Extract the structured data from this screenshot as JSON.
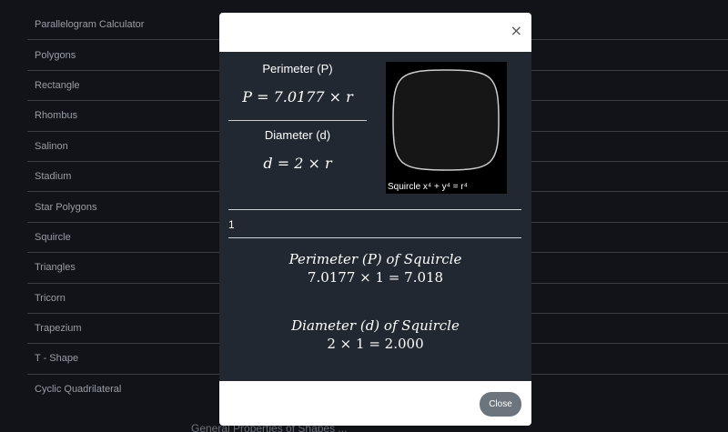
{
  "background": {
    "items": [
      "Parallelogram Calculator",
      "Polygons",
      "Rectangle",
      "Rhombus",
      "Salinon",
      "Stadium",
      "Star Polygons",
      "Squircle",
      "Triangles",
      "Tricorn",
      "Trapezium",
      "T - Shape",
      "Cyclic Quadrilateral"
    ],
    "footer_text": "General Properties of Shapes ..."
  },
  "modal": {
    "close_x": "×",
    "perimeter_label": "Perimeter (P)",
    "perimeter_formula": "P = 7.0177 × r",
    "diameter_label": "Diameter (d)",
    "diameter_formula": "d = 2 × r",
    "shape_caption": "Squircle x⁴ + y⁴ = r⁴",
    "input_value": "1",
    "result_perimeter_title": "Perimeter (P) of Squircle",
    "result_perimeter_expr": "7.0177 × 1 = 7.018",
    "result_diameter_title": "Diameter (d) of Squircle",
    "result_diameter_expr": "2 × 1 = 2.000",
    "close_button": "Close"
  },
  "colors": {
    "page_bg": "#111318",
    "modal_body": "#222831",
    "close_button_bg": "#6c757d"
  }
}
